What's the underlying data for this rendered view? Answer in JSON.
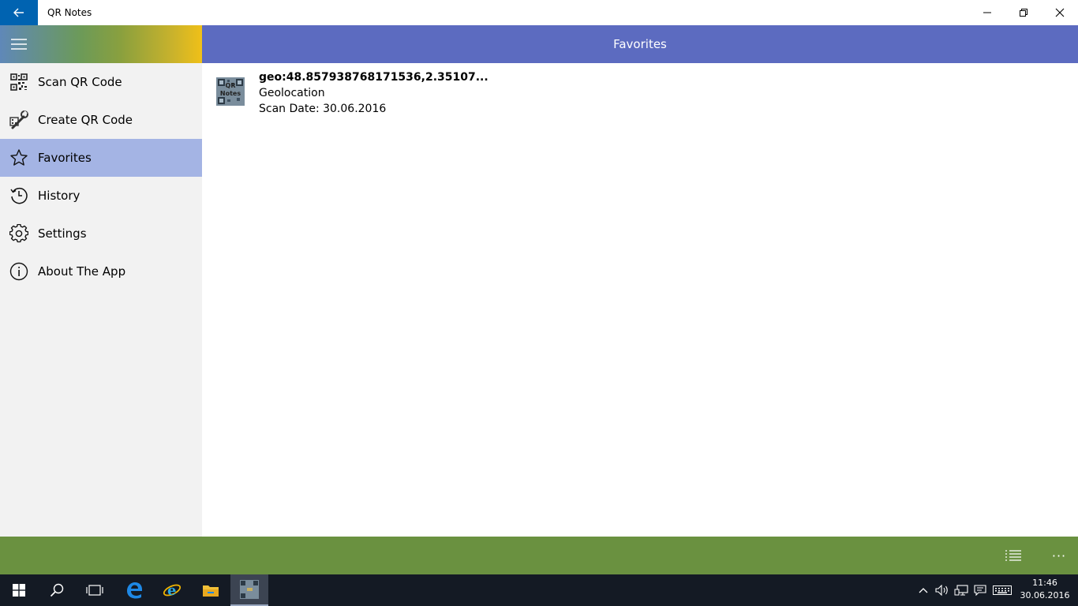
{
  "window": {
    "title": "QR Notes"
  },
  "header": {
    "title": "Favorites"
  },
  "sidebar": {
    "items": [
      {
        "label": "Scan QR Code",
        "icon": "qr-scan-icon"
      },
      {
        "label": "Create QR Code",
        "icon": "qr-wrench-icon"
      },
      {
        "label": "Favorites",
        "icon": "star-icon",
        "selected": true
      },
      {
        "label": "History",
        "icon": "history-icon"
      },
      {
        "label": "Settings",
        "icon": "gear-icon"
      },
      {
        "label": "About The App",
        "icon": "info-icon"
      }
    ]
  },
  "favorites": [
    {
      "title": "geo:48.857938768171536,2.35107...",
      "type": "Geolocation",
      "scan_date": "Scan Date: 30.06.2016",
      "thumb_text": "QR Notes"
    }
  ],
  "appbar": {
    "more": "···"
  },
  "taskbar": {
    "time": "11:46",
    "date": "30.06.2016"
  },
  "colors": {
    "header": "#5c6bc0",
    "selected": "#a4b4e4",
    "appbar": "#6a9140",
    "back_button": "#0063b1",
    "taskbar": "#141a24"
  }
}
